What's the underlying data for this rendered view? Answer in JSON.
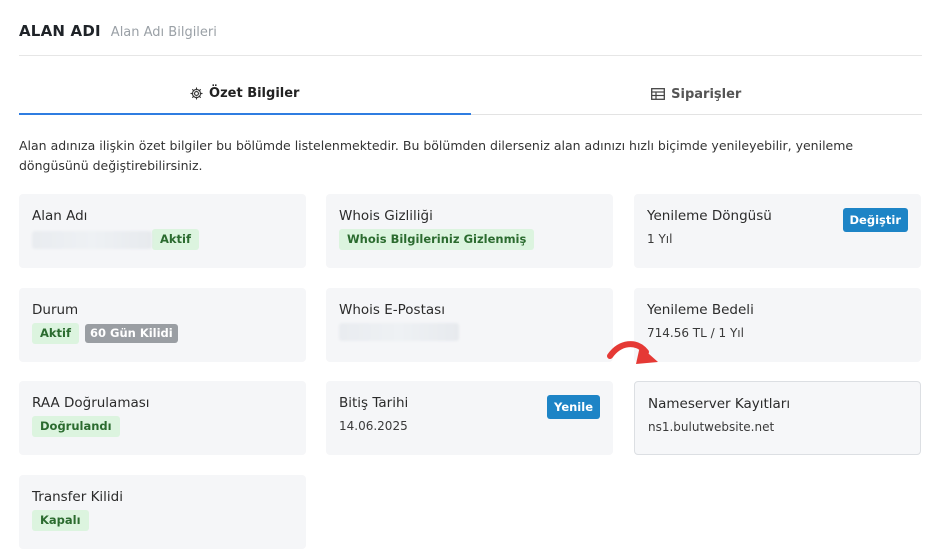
{
  "header": {
    "title": "ALAN ADI",
    "subtitle": "Alan Adı Bilgileri"
  },
  "tabs": [
    {
      "label": "Özet Bilgiler",
      "icon": "gear-icon",
      "active": true
    },
    {
      "label": "Siparişler",
      "icon": "table-icon",
      "active": false
    }
  ],
  "intro": "Alan adınıza ilişkin özet bilgiler bu bölümde listelenmektedir. Bu bölümden dilerseniz alan adınızı hızlı biçimde yenileyebilir, yenileme döngüsünü değiştirebilirsiniz.",
  "cards": {
    "domain": {
      "label": "Alan Adı",
      "status": "Aktif"
    },
    "whois_privacy": {
      "label": "Whois Gizliliği",
      "status": "Whois Bilgileriniz Gizlenmiş"
    },
    "renewal_cycle": {
      "label": "Yenileme Döngüsü",
      "value": "1 Yıl",
      "button": "Değiştir"
    },
    "state": {
      "label": "Durum",
      "status": "Aktif",
      "lock": "60 Gün Kilidi"
    },
    "whois_email": {
      "label": "Whois E-Postası"
    },
    "renewal_fee": {
      "label": "Yenileme Bedeli",
      "value": "714.56 TL / 1 Yıl"
    },
    "raa": {
      "label": "RAA Doğrulaması",
      "status": "Doğrulandı"
    },
    "expiry": {
      "label": "Bitiş Tarihi",
      "value": "14.06.2025",
      "button": "Yenile"
    },
    "nameserver": {
      "label": "Nameserver Kayıtları",
      "value": "ns1.bulutwebsite.net"
    },
    "transfer_lock": {
      "label": "Transfer Kilidi",
      "status": "Kapalı"
    }
  },
  "colors": {
    "accent": "#2f7de1",
    "button": "#1d84c6",
    "badge_green_bg": "#dcf4df",
    "arrow": "#e53935"
  }
}
